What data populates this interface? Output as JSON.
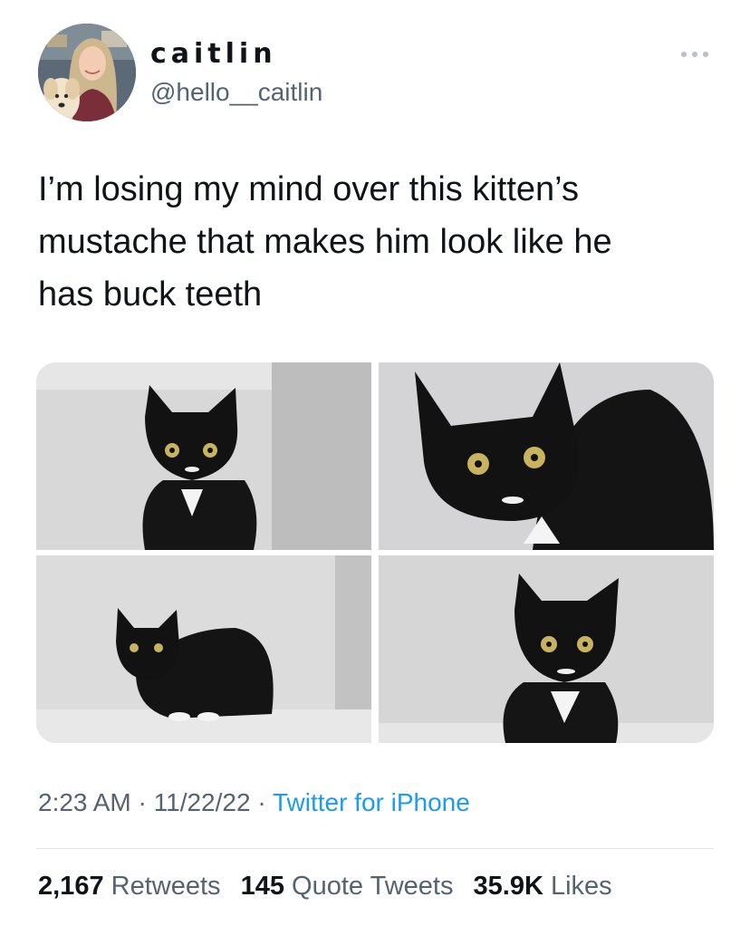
{
  "user": {
    "display_name": "caitlin",
    "handle": "@hello__caitlin",
    "avatar_icon": "profile-photo-woman-with-dog"
  },
  "more_icon": "ellipsis-icon",
  "tweet": {
    "text_lines": [
      "I’m losing my mind over this kitten’s",
      "mustache that makes him look like he",
      "has buck teeth"
    ]
  },
  "media": {
    "count": 4,
    "photos": [
      {
        "subject": "black and white kitten facing camera"
      },
      {
        "subject": "close-up of kitten face"
      },
      {
        "subject": "kitten crouching in corner"
      },
      {
        "subject": "kitten sitting, front view"
      }
    ]
  },
  "meta": {
    "time": "2:23 AM",
    "separator": "·",
    "date": "11/22/22",
    "source": "Twitter for iPhone"
  },
  "stats": {
    "retweets_count": "2,167",
    "retweets_label": "Retweets",
    "quotes_count": "145",
    "quotes_label": "Quote Tweets",
    "likes_count": "35.9K",
    "likes_label": "Likes"
  },
  "colors": {
    "text": "#0f1419",
    "secondary": "#536471",
    "link": "#1d9bf0",
    "divider": "#e1e6ea"
  }
}
